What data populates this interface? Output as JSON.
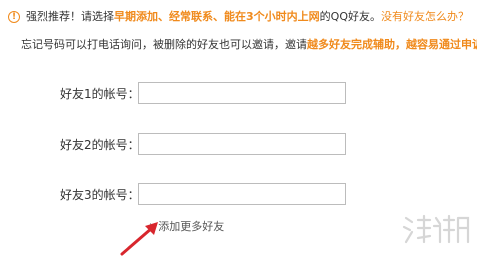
{
  "tip": {
    "icon": "info-circle-icon",
    "lead": "强烈推荐！请选择",
    "highlight_1": "早期添加、经常联系、能在3个小时内上网",
    "middle": "的QQ好友。",
    "question": "没有好友怎么办？"
  },
  "description": {
    "text_1": "忘记号码可以打电话询问，被删除的好友也可以邀请，邀请",
    "highlight_1": "越多好友完成辅助，越容易通过申诉。"
  },
  "fields": [
    {
      "label": "好友1的帐号：",
      "value": "",
      "placeholder": ""
    },
    {
      "label": "好友2的帐号：",
      "value": "",
      "placeholder": ""
    },
    {
      "label": "好友3的帐号：",
      "value": "",
      "placeholder": ""
    }
  ],
  "add_more": {
    "icon": "plus-icon",
    "label": "添加更多好友"
  },
  "annotation": {
    "arrow_color": "#d8262d"
  },
  "watermark": {
    "text": "游侠网"
  },
  "colors": {
    "accent": "#f08a1c",
    "border": "#bcbcbc",
    "arrow": "#d8262d"
  }
}
